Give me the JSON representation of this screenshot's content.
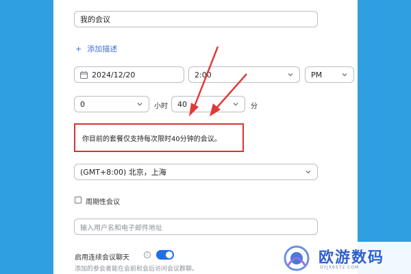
{
  "meeting": {
    "topic_value": "我的会议",
    "add_description_label": "添加描述",
    "date_value": "2024/12/20",
    "time_value": "2:00",
    "ampm_value": "PM",
    "duration_hours_value": "0",
    "hours_unit": "小时",
    "duration_minutes_value": "40",
    "minutes_unit": "分",
    "limit_notice": "你目前的套餐仅支持每次限时40分钟的会议。",
    "timezone_value": "(GMT+8:00) 北京，上海",
    "recurring_label": "周期性会议",
    "invitees_placeholder": "输入用户名和电子邮件地址",
    "continuous_chat_label": "启用连续会议聊天",
    "continuous_chat_desc": "添加的参会者能在会前和会后访问会议群聊。"
  },
  "watermark": {
    "brand_text": "欧游数码",
    "brand_sub": "OYJX6572.COM"
  },
  "colors": {
    "background": "#2f9fe2",
    "accent": "#1f6fe5",
    "annotation_red": "#d93030"
  },
  "icons": {
    "calendar": "calendar-icon",
    "dropdown": "chevron-down-icon",
    "add": "plus-icon",
    "info": "info-icon"
  }
}
